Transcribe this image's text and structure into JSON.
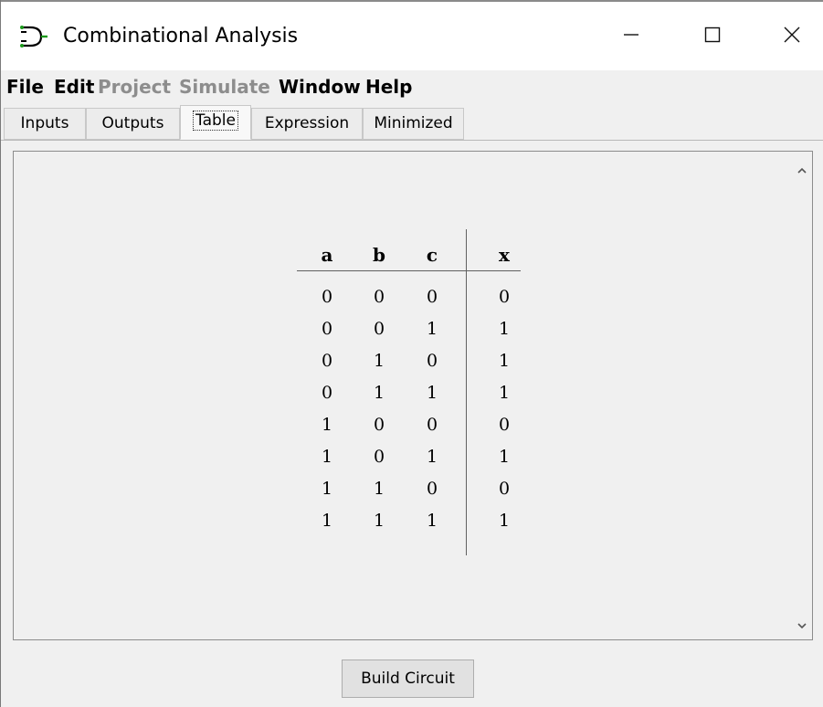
{
  "window": {
    "title": "Combinational Analysis",
    "minimize_icon": "minimize-icon",
    "maximize_icon": "maximize-icon",
    "close_icon": "close-icon",
    "app_icon": "logisim-gate-icon"
  },
  "menubar": {
    "items": [
      {
        "label": "File",
        "enabled": true
      },
      {
        "label": "Edit",
        "enabled": true
      },
      {
        "label": "Project",
        "enabled": false
      },
      {
        "label": "Simulate",
        "enabled": false
      },
      {
        "label": "Window",
        "enabled": true
      },
      {
        "label": "Help",
        "enabled": true
      }
    ]
  },
  "tabs": [
    {
      "label": "Inputs",
      "active": false
    },
    {
      "label": "Outputs",
      "active": false
    },
    {
      "label": "Table",
      "active": true
    },
    {
      "label": "Expression",
      "active": false
    },
    {
      "label": "Minimized",
      "active": false
    }
  ],
  "truth_table": {
    "inputs": [
      "a",
      "b",
      "c"
    ],
    "outputs": [
      "x"
    ],
    "rows": [
      [
        "0",
        "0",
        "0",
        "0"
      ],
      [
        "0",
        "0",
        "1",
        "1"
      ],
      [
        "0",
        "1",
        "0",
        "1"
      ],
      [
        "0",
        "1",
        "1",
        "1"
      ],
      [
        "1",
        "0",
        "0",
        "0"
      ],
      [
        "1",
        "0",
        "1",
        "1"
      ],
      [
        "1",
        "1",
        "0",
        "0"
      ],
      [
        "1",
        "1",
        "1",
        "1"
      ]
    ]
  },
  "footer": {
    "build_button_label": "Build Circuit"
  },
  "icons": {
    "scroll_up": "chevron-up-icon",
    "scroll_down": "chevron-down-icon"
  }
}
